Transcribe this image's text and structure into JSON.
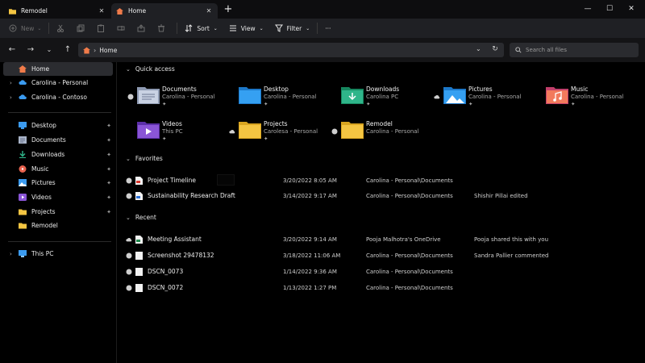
{
  "tabs": [
    {
      "label": "Remodel",
      "icon": "folder-icon",
      "close": "✕"
    },
    {
      "label": "Home",
      "icon": "home-icon",
      "close": "✕"
    }
  ],
  "new_tab": "+",
  "window_controls": {
    "minimize": "—",
    "maximize": "☐",
    "close": "✕"
  },
  "toolbar": {
    "new_label": "New",
    "sort_label": "Sort",
    "view_label": "View",
    "filter_label": "Filter",
    "more_label": "···"
  },
  "nav": {
    "back": "←",
    "forward": "→",
    "recent": "⌄",
    "up": "↑"
  },
  "address": {
    "root": "Home",
    "separator": "›",
    "dropdown": "⌄",
    "refresh": "↻"
  },
  "search": {
    "placeholder": "Search all files"
  },
  "sidebar": {
    "items": [
      {
        "label": "Home",
        "icon": "home-icon"
      },
      {
        "label": "Carolina - Personal",
        "icon": "onedrive-personal-icon",
        "arrow": "›"
      },
      {
        "label": "Carolina - Contoso",
        "icon": "onedrive-business-icon",
        "arrow": "›"
      },
      {
        "label": "Desktop",
        "icon": "desktop-icon",
        "pinned": true
      },
      {
        "label": "Documents",
        "icon": "documents-icon",
        "pinned": true
      },
      {
        "label": "Downloads",
        "icon": "downloads-icon",
        "pinned": true
      },
      {
        "label": "Music",
        "icon": "music-icon",
        "pinned": true
      },
      {
        "label": "Pictures",
        "icon": "pictures-icon",
        "pinned": true
      },
      {
        "label": "Videos",
        "icon": "videos-icon",
        "pinned": true
      },
      {
        "label": "Projects",
        "icon": "folder-icon",
        "pinned": true
      },
      {
        "label": "Remodel",
        "icon": "folder-icon"
      },
      {
        "label": "This PC",
        "icon": "this-pc-icon",
        "arrow": "›"
      }
    ],
    "pin_glyph": "📌"
  },
  "quick_access": {
    "title": "Quick access",
    "tiles": [
      {
        "name": "Documents",
        "sub": "Carolina - Personal",
        "icon": "documents-folder-icon",
        "status": "synced"
      },
      {
        "name": "Desktop",
        "sub": "Carolina - Personal",
        "icon": "desktop-folder-icon",
        "status": "none"
      },
      {
        "name": "Downloads",
        "sub": "Carolina PC",
        "icon": "downloads-folder-icon",
        "status": "none"
      },
      {
        "name": "Pictures",
        "sub": "Carolina - Personal",
        "icon": "pictures-folder-icon",
        "status": "cloud"
      },
      {
        "name": "Music",
        "sub": "Carolina - Personal",
        "icon": "music-folder-icon",
        "status": "none"
      },
      {
        "name": "Videos",
        "sub": "This PC",
        "icon": "videos-folder-icon",
        "status": "none"
      },
      {
        "name": "Projects",
        "sub": "Carolesa - Personal",
        "icon": "projects-folder-icon",
        "status": "cloud"
      },
      {
        "name": "Remodel",
        "sub": "Carolina - Personal",
        "icon": "remodel-folder-icon",
        "status": "synced"
      }
    ],
    "pin_glyph": "📌"
  },
  "favorites": {
    "title": "Favorites",
    "rows": [
      {
        "name": "Project Timeline",
        "date": "3/20/2022 8:05 AM",
        "location": "Carolina - Personal\\Documents",
        "activity": "",
        "icon": "pdf-file-icon"
      },
      {
        "name": "Sustainability Research Draft",
        "date": "3/14/2022 9:17 AM",
        "location": "Carolina - Personal\\Documents",
        "activity": "Shishir Pillai edited",
        "icon": "word-file-icon"
      }
    ]
  },
  "recent": {
    "title": "Recent",
    "rows": [
      {
        "name": "Meeting Assistant",
        "date": "3/20/2022 9:14 AM",
        "location": "Pooja Malhotra's OneDrive",
        "activity": "Pooja shared this with you",
        "icon": "excel-file-icon",
        "status": "cloud"
      },
      {
        "name": "Screenshot 29478132",
        "date": "3/18/2022 11:06 AM",
        "location": "Carolina - Personal\\Documents",
        "activity": "Sandra Pallier commented",
        "icon": "image-file-icon",
        "status": "synced"
      },
      {
        "name": "DSCN_0073",
        "date": "1/14/2022 9:36 AM",
        "location": "Carolina - Personal\\Documents",
        "activity": "",
        "icon": "image-file-icon",
        "status": "synced"
      },
      {
        "name": "DSCN_0072",
        "date": "1/13/2022 1:27 PM",
        "location": "Carolina - Personal\\Documents",
        "activity": "",
        "icon": "image-file-icon",
        "status": "synced"
      }
    ]
  },
  "colors": {
    "accent": "#4aa3ff",
    "folder": "#f4c542",
    "background": "#000000",
    "chrome": "#1f2024"
  }
}
